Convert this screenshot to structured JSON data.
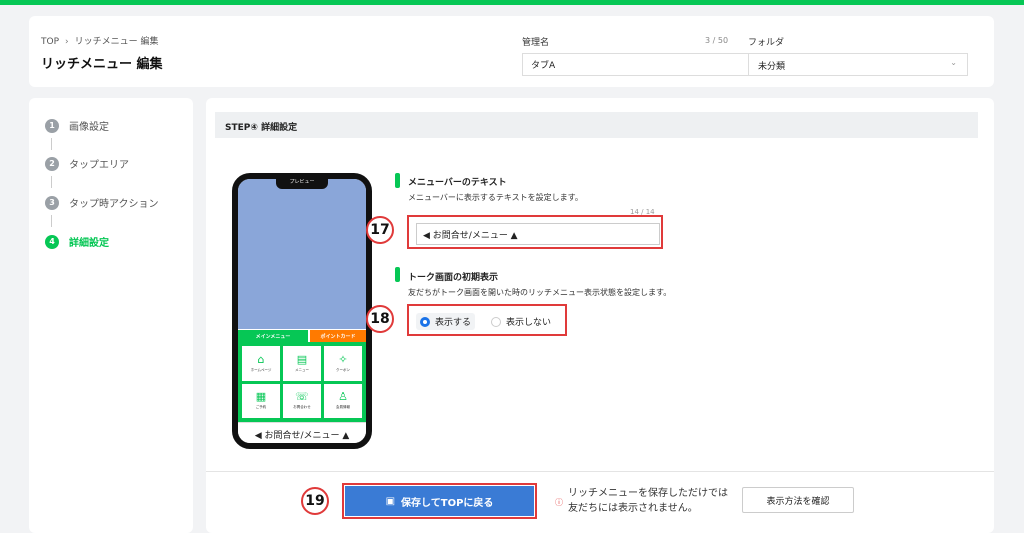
{
  "header": {
    "breadcrumb": [
      "TOP",
      "リッチメニュー 編集"
    ],
    "breadcrumb_sep": "›",
    "title": "リッチメニュー 編集",
    "admin_name_label": "管理名",
    "admin_name_value": "タブA",
    "admin_name_count": "3 / 50",
    "folder_label": "フォルダ",
    "folder_value": "未分類"
  },
  "steps": [
    {
      "num": "1",
      "label": "画像設定"
    },
    {
      "num": "2",
      "label": "タップエリア"
    },
    {
      "num": "3",
      "label": "タップ時アクション"
    },
    {
      "num": "4",
      "label": "詳細設定"
    }
  ],
  "main": {
    "step_heading": "STEP④ 詳細設定",
    "menu_text_section": {
      "title": "メニューバーのテキスト",
      "description": "メニューバーに表示するテキストを設定します。",
      "char_count": "14 / 14",
      "value": "◀ お問合せ/メニュー ▲"
    },
    "initial_display_section": {
      "title": "トーク画面の初期表示",
      "description": "友だちがトーク画面を開いた時のリッチメニュー表示状態を設定します。",
      "options": [
        "表示する",
        "表示しない"
      ],
      "selected": "表示する"
    },
    "badges": [
      "17",
      "18",
      "19"
    ]
  },
  "phone_preview": {
    "notch_label": "プレビュー",
    "tab_main": "メインメニュー",
    "tab_point": "ポイントカード",
    "cells": [
      {
        "icon": "home-icon",
        "glyph": "⌂",
        "label": "ホームページ"
      },
      {
        "icon": "menu-icon",
        "glyph": "▤",
        "label": "メニュー"
      },
      {
        "icon": "coupon-icon",
        "glyph": "✧",
        "label": "クーポン"
      },
      {
        "icon": "calendar-icon",
        "glyph": "▦",
        "label": "ご予約"
      },
      {
        "icon": "chat-icon",
        "glyph": "☏",
        "label": "お問合わせ"
      },
      {
        "icon": "person-icon",
        "glyph": "♙",
        "label": "会員情報"
      }
    ],
    "menubar_text": "◀ お問合せ/メニュー ▲"
  },
  "footer": {
    "save_button": "保存してTOPに戻る",
    "warning_icon": "ⓘ",
    "note_line1": "リッチメニューを保存しただけでは",
    "note_line2": "友だちには表示されません。",
    "check_button": "表示方法を確認"
  },
  "colors": {
    "brand_green": "#06c755",
    "save_blue": "#3a7bd5",
    "highlight_red": "#e03a3a",
    "point_orange": "#ff7a00"
  }
}
